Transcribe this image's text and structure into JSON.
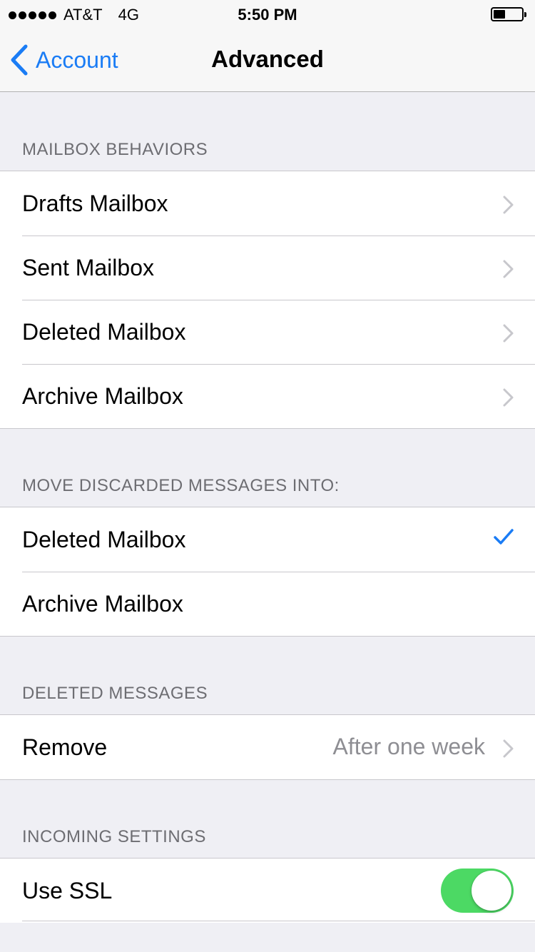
{
  "status": {
    "carrier": "AT&T",
    "network": "4G",
    "time": "5:50 PM"
  },
  "nav": {
    "back_label": "Account",
    "title": "Advanced"
  },
  "sections": {
    "mailbox_behaviors": {
      "header": "MAILBOX BEHAVIORS",
      "items": [
        {
          "label": "Drafts Mailbox"
        },
        {
          "label": "Sent Mailbox"
        },
        {
          "label": "Deleted Mailbox"
        },
        {
          "label": "Archive Mailbox"
        }
      ]
    },
    "move_discarded": {
      "header": "MOVE DISCARDED MESSAGES INTO:",
      "items": [
        {
          "label": "Deleted Mailbox",
          "selected": true
        },
        {
          "label": "Archive Mailbox",
          "selected": false
        }
      ]
    },
    "deleted_messages": {
      "header": "DELETED MESSAGES",
      "remove_label": "Remove",
      "remove_value": "After one week"
    },
    "incoming_settings": {
      "header": "INCOMING SETTINGS",
      "ssl_label": "Use SSL",
      "ssl_enabled": true
    }
  },
  "colors": {
    "accent": "#1a7cf5",
    "toggle_on": "#4cd964",
    "background": "#efeff4"
  }
}
